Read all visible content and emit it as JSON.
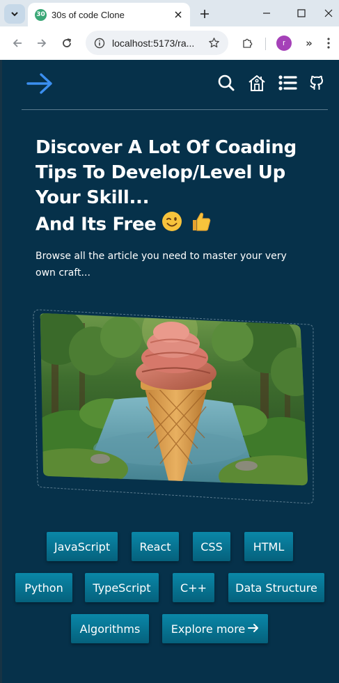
{
  "browser": {
    "tab_title": "30s of code Clone",
    "favicon_text": "30",
    "url": "localhost:5173/ra...",
    "profile_initial": "r",
    "overflow_chevron": "»"
  },
  "header": {
    "logo_icon": "arrow-right-icon",
    "icons": [
      "search-icon",
      "home-icon",
      "list-icon",
      "github-icon"
    ]
  },
  "hero": {
    "title_line1": "Discover A Lot Of Coading",
    "title_line2": "Tips To Develop/Level Up",
    "title_line3": "Your Skill...",
    "title_line4": "And Its Free",
    "emoji_wink": "winking-face-icon",
    "emoji_thumbs": "thumbs-up-icon",
    "subtitle": "Browse all the article you need to master your very own craft..."
  },
  "tags": {
    "row1": [
      "JavaScript",
      "React",
      "CSS",
      "HTML"
    ],
    "row2": [
      "Python",
      "TypeScript",
      "C++",
      "Data Structure"
    ],
    "row3": [
      "Algorithms"
    ],
    "explore": "Explore more"
  },
  "colors": {
    "page_bg": "#06314a",
    "accent_blue": "#3b8ff0",
    "tag_bg": "#067a9a"
  }
}
